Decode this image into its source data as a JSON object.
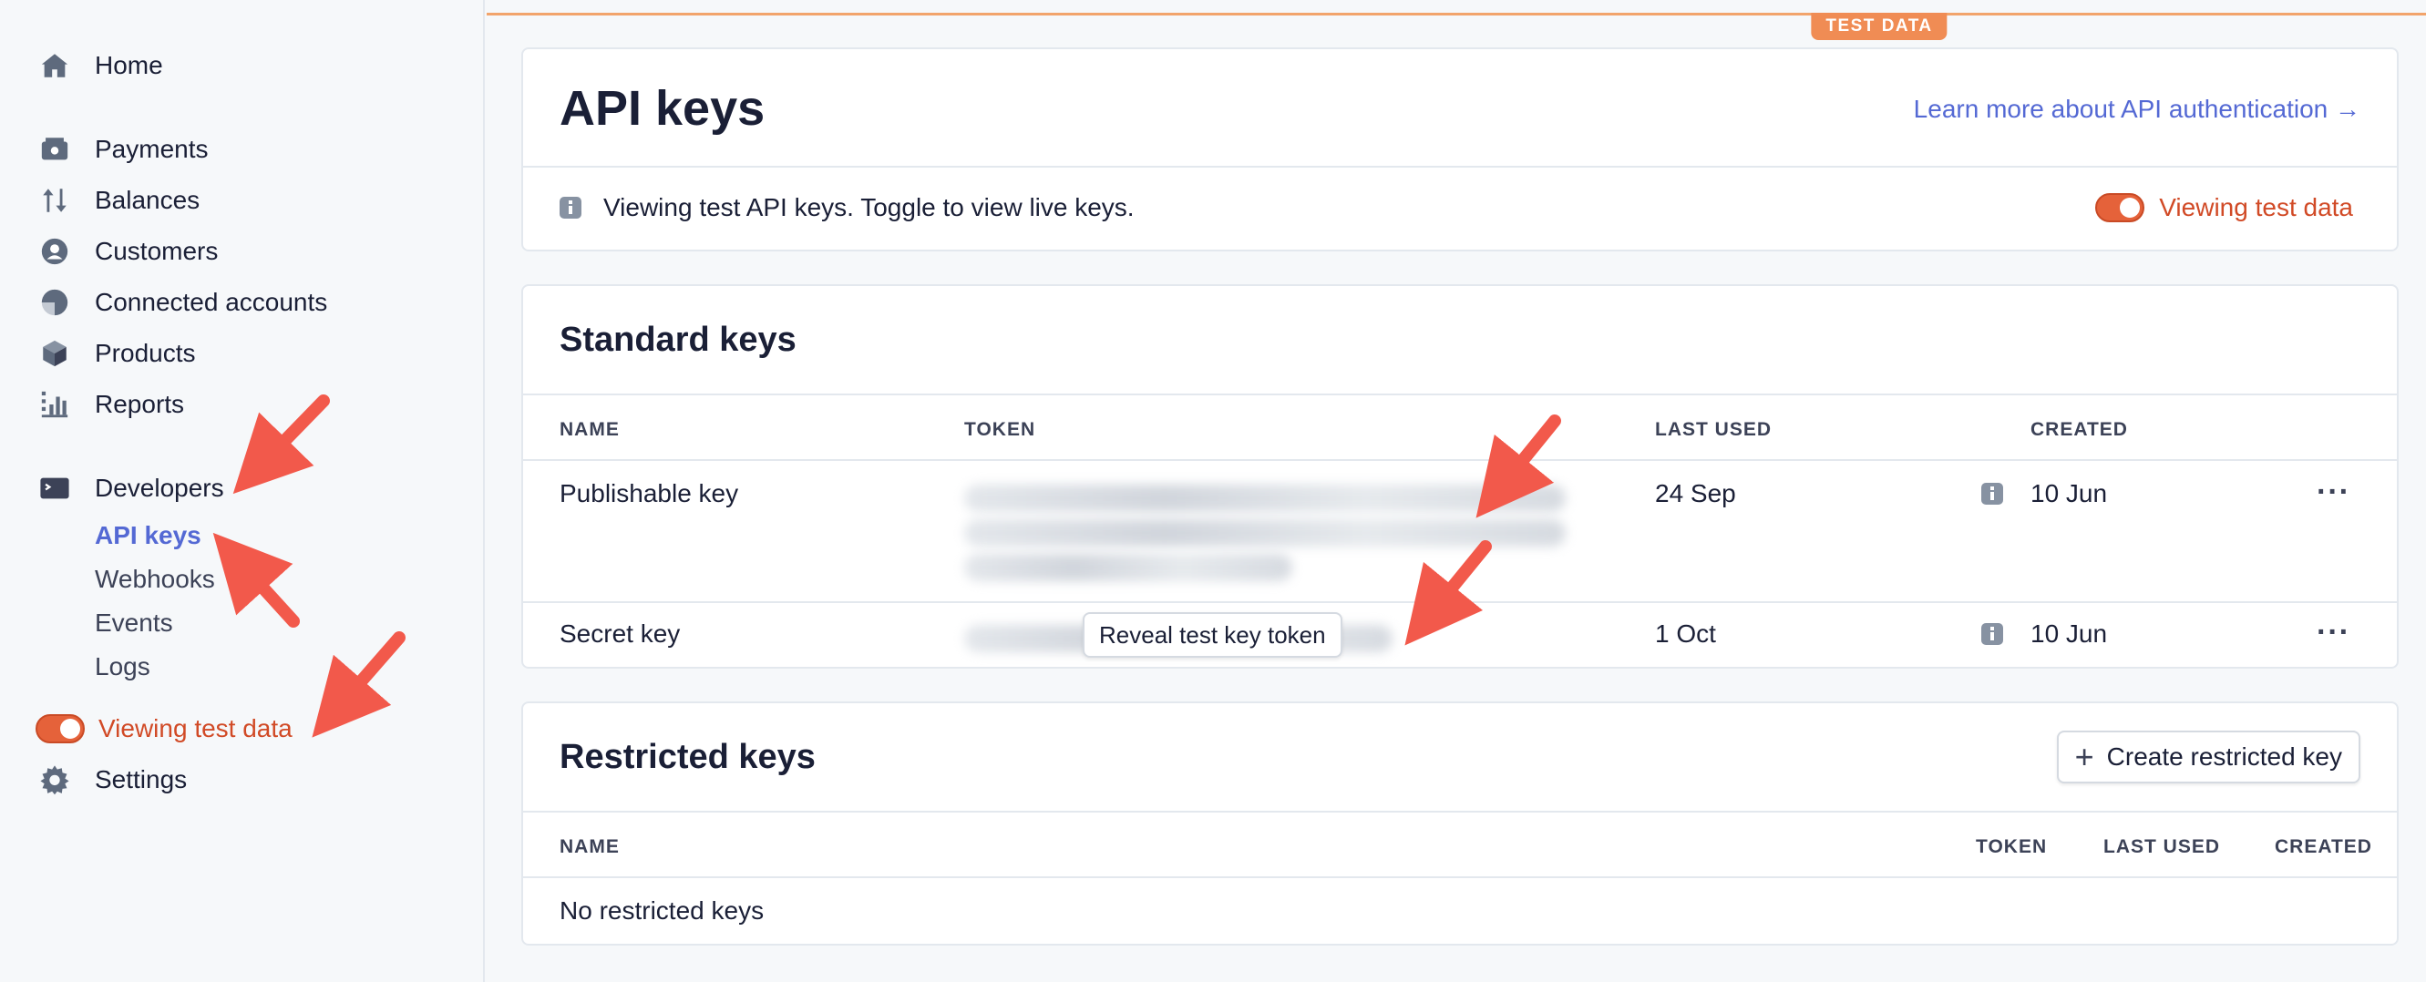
{
  "sidebar": {
    "items": [
      {
        "label": "Home",
        "icon": "home-icon"
      },
      {
        "label": "Payments",
        "icon": "payments-icon"
      },
      {
        "label": "Balances",
        "icon": "balances-icon"
      },
      {
        "label": "Customers",
        "icon": "customers-icon"
      },
      {
        "label": "Connected accounts",
        "icon": "connected-accounts-icon"
      },
      {
        "label": "Products",
        "icon": "products-icon"
      },
      {
        "label": "Reports",
        "icon": "reports-icon"
      },
      {
        "label": "Developers",
        "icon": "terminal-icon"
      }
    ],
    "sub_items": [
      {
        "label": "API keys",
        "active": true
      },
      {
        "label": "Webhooks"
      },
      {
        "label": "Events"
      },
      {
        "label": "Logs"
      }
    ],
    "test_toggle_label": "Viewing test data",
    "settings_label": "Settings"
  },
  "main": {
    "test_badge": "TEST DATA",
    "title": "API keys",
    "learn_more": "Learn more about API authentication →",
    "info_text": "Viewing test API keys. Toggle to view live keys.",
    "test_toggle_label": "Viewing test data",
    "standard": {
      "title": "Standard keys",
      "headers": [
        "NAME",
        "TOKEN",
        "LAST USED",
        "CREATED"
      ],
      "rows": [
        {
          "name": "Publishable key",
          "last_used": "24 Sep",
          "created": "10 Jun"
        },
        {
          "name": "Secret key",
          "last_used": "1 Oct",
          "created": "10 Jun"
        }
      ],
      "reveal_label": "Reveal test key token"
    },
    "restricted": {
      "title": "Restricted keys",
      "create_label": "Create restricted key",
      "headers": [
        "NAME",
        "TOKEN",
        "LAST USED",
        "CREATED"
      ],
      "empty": "No restricted keys"
    }
  },
  "colors": {
    "accent": "#5469d4",
    "test": "#d14a26",
    "arrow": "#f2594b"
  }
}
